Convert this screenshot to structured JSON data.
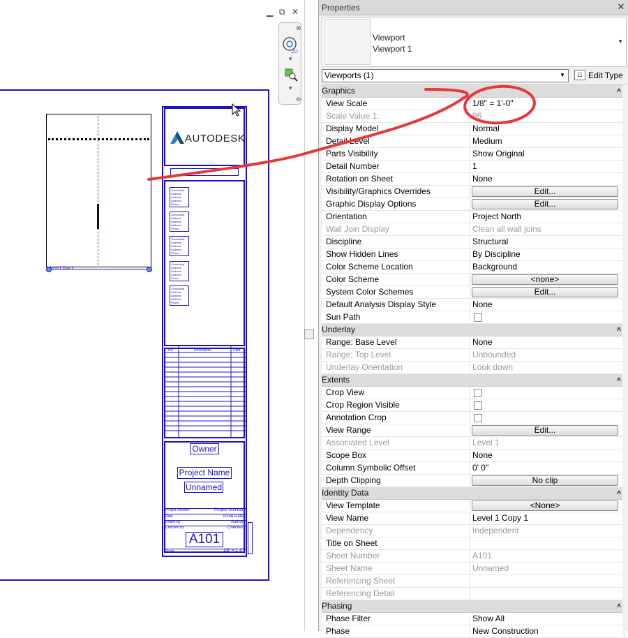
{
  "drawing": {
    "autodesk_logo": "AUTODESK.",
    "consultant_block": "Consultant\nAddress\nAddress\nAddress\nPhone",
    "revision_headers": [
      "No.",
      "Description",
      "Date"
    ],
    "owner": "Owner",
    "project_name": "Project Name",
    "unnamed": "Unnamed",
    "project_number_label": "Project Number",
    "project_number": "Project Number",
    "date_label": "Date",
    "issue_date": "Issue Date",
    "drawn_by_label": "Drawn By",
    "author": "Author",
    "checked_by_label": "Checked By",
    "checker": "Checker",
    "sheet_number": "A101",
    "scale_label": "Scale",
    "scale_value": "1/8\" = 1'-0\"",
    "viewport_label": "Level 1 Copy 1"
  },
  "properties": {
    "title": "Properties",
    "type_line1": "Viewport",
    "type_line2": "Viewport 1",
    "instance_filter": "Viewports (1)",
    "edit_type": "Edit Type",
    "groups": {
      "graphics": "Graphics",
      "underlay": "Underlay",
      "extents": "Extents",
      "identity": "Identity Data",
      "phasing": "Phasing"
    },
    "rows": {
      "view_scale": {
        "label": "View Scale",
        "value": "1/8\" = 1'-0\""
      },
      "scale_value": {
        "label": "Scale Value    1:",
        "value": "96"
      },
      "display_model": {
        "label": "Display Model",
        "value": "Normal"
      },
      "detail_level": {
        "label": "Detail Level",
        "value": "Medium"
      },
      "parts_visibility": {
        "label": "Parts Visibility",
        "value": "Show Original"
      },
      "detail_number": {
        "label": "Detail Number",
        "value": "1"
      },
      "rotation": {
        "label": "Rotation on Sheet",
        "value": "None"
      },
      "vg_overrides": {
        "label": "Visibility/Graphics Overrides",
        "value": "Edit..."
      },
      "graphic_display": {
        "label": "Graphic Display Options",
        "value": "Edit..."
      },
      "orientation": {
        "label": "Orientation",
        "value": "Project North"
      },
      "wall_join": {
        "label": "Wall Join Display",
        "value": "Clean all wall joins"
      },
      "discipline": {
        "label": "Discipline",
        "value": "Structural"
      },
      "hidden_lines": {
        "label": "Show Hidden Lines",
        "value": "By Discipline"
      },
      "color_scheme_loc": {
        "label": "Color Scheme Location",
        "value": "Background"
      },
      "color_scheme": {
        "label": "Color Scheme",
        "value": "<none>"
      },
      "system_color": {
        "label": "System Color Schemes",
        "value": "Edit..."
      },
      "analysis_style": {
        "label": "Default Analysis Display Style",
        "value": "None"
      },
      "sun_path": {
        "label": "Sun Path",
        "value": ""
      },
      "base_level": {
        "label": "Range: Base Level",
        "value": "None"
      },
      "top_level": {
        "label": "Range: Top Level",
        "value": "Unbounded"
      },
      "underlay_orient": {
        "label": "Underlay Orientation",
        "value": "Look down"
      },
      "crop_view": {
        "label": "Crop View",
        "value": ""
      },
      "crop_region": {
        "label": "Crop Region Visible",
        "value": ""
      },
      "annotation_crop": {
        "label": "Annotation Crop",
        "value": ""
      },
      "view_range": {
        "label": "View Range",
        "value": "Edit..."
      },
      "assoc_level": {
        "label": "Associated Level",
        "value": "Level 1"
      },
      "scope_box": {
        "label": "Scope Box",
        "value": "None"
      },
      "col_offset": {
        "label": "Column Symbolic Offset",
        "value": "0'  0\""
      },
      "depth_clip": {
        "label": "Depth Clipping",
        "value": "No clip"
      },
      "view_template": {
        "label": "View Template",
        "value": "<None>"
      },
      "view_name": {
        "label": "View Name",
        "value": "Level 1 Copy 1"
      },
      "dependency": {
        "label": "Dependency",
        "value": "Independent"
      },
      "title_on_sheet": {
        "label": "Title on Sheet",
        "value": ""
      },
      "sheet_number": {
        "label": "Sheet Number",
        "value": "A101"
      },
      "sheet_name": {
        "label": "Sheet Name",
        "value": "Unnamed"
      },
      "ref_sheet": {
        "label": "Referencing Sheet",
        "value": ""
      },
      "ref_detail": {
        "label": "Referencing Detail",
        "value": ""
      },
      "phase_filter": {
        "label": "Phase Filter",
        "value": "Show All"
      },
      "phase": {
        "label": "Phase",
        "value": "New Construction"
      }
    }
  },
  "colors": {
    "sheet_line": "#1b12c8",
    "annotation": "#e8373a"
  },
  "icons": [
    "close-icon",
    "minimize-icon",
    "restore-icon",
    "steering-wheel-icon",
    "zoom-region-icon",
    "edit-type-icon",
    "collapse-caret-icon"
  ]
}
